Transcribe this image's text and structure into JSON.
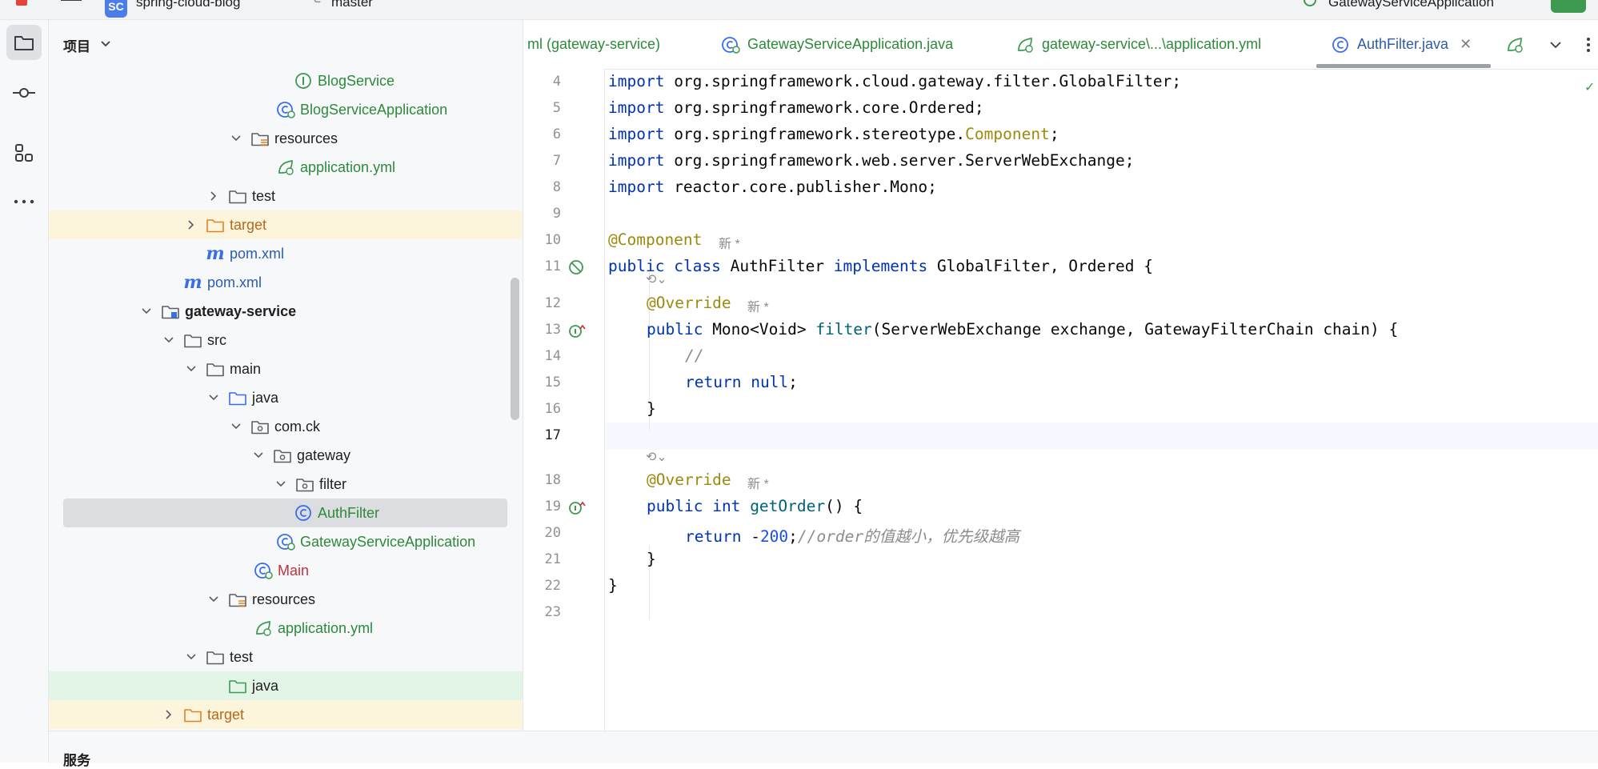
{
  "top_bar": {
    "project_badge": "SC",
    "project_name": "spring-cloud-blog",
    "branch": "master",
    "run_config": "GatewayServiceApplication"
  },
  "tool_strip": {
    "items": [
      {
        "name": "project",
        "icon": "folder-icon"
      },
      {
        "name": "commit",
        "icon": "commit-icon"
      },
      {
        "name": "structure",
        "icon": "structure-icon"
      },
      {
        "name": "more",
        "icon": "more-icon"
      }
    ]
  },
  "project_panel": {
    "title": "项目",
    "tree": [
      {
        "label": "BlogService",
        "icon": "interface",
        "color": "green"
      },
      {
        "label": "BlogServiceApplication",
        "icon": "spring-class",
        "color": "green"
      },
      {
        "label": "resources",
        "icon": "resources-folder",
        "color": "default",
        "expanded": true
      },
      {
        "label": "application.yml",
        "icon": "spring-yml",
        "color": "green"
      },
      {
        "label": "test",
        "icon": "folder",
        "color": "default",
        "expanded": false
      },
      {
        "label": "target",
        "icon": "orange-folder",
        "color": "orange",
        "expanded": false
      },
      {
        "label": "pom.xml",
        "icon": "maven",
        "color": "blue"
      },
      {
        "label": "pom.xml",
        "icon": "maven",
        "color": "blue"
      },
      {
        "label": "gateway-service",
        "icon": "module-folder",
        "color": "bold",
        "expanded": true
      },
      {
        "label": "src",
        "icon": "folder",
        "color": "default",
        "expanded": true
      },
      {
        "label": "main",
        "icon": "folder",
        "color": "default",
        "expanded": true
      },
      {
        "label": "java",
        "icon": "blue-folder",
        "color": "default",
        "expanded": true
      },
      {
        "label": "com.ck",
        "icon": "package",
        "color": "default",
        "expanded": true
      },
      {
        "label": "gateway",
        "icon": "package",
        "color": "default",
        "expanded": true
      },
      {
        "label": "filter",
        "icon": "package",
        "color": "default",
        "expanded": true
      },
      {
        "label": "AuthFilter",
        "icon": "class",
        "color": "green"
      },
      {
        "label": "GatewayServiceApplication",
        "icon": "spring-class",
        "color": "green"
      },
      {
        "label": "Main",
        "icon": "spring-class",
        "color": "red"
      },
      {
        "label": "resources",
        "icon": "resources-folder",
        "color": "default",
        "expanded": true
      },
      {
        "label": "application.yml",
        "icon": "spring-yml",
        "color": "green"
      },
      {
        "label": "test",
        "icon": "folder",
        "color": "default",
        "expanded": true
      },
      {
        "label": "java",
        "icon": "green-folder",
        "color": "default"
      },
      {
        "label": "target",
        "icon": "orange-folder",
        "color": "orange",
        "expanded": false
      }
    ]
  },
  "editor": {
    "tabs": [
      {
        "label": "ml (gateway-service)",
        "icon": "none"
      },
      {
        "label": "GatewayServiceApplication.java",
        "icon": "spring-class"
      },
      {
        "label": "gateway-service\\...\\application.yml",
        "icon": "spring-yml"
      },
      {
        "label": "AuthFilter.java",
        "icon": "class",
        "active": true
      }
    ],
    "line_numbers": [
      "4",
      "5",
      "6",
      "7",
      "8",
      "9",
      "10",
      "11",
      "12",
      "13",
      "14",
      "15",
      "16",
      "17",
      "18",
      "19",
      "20",
      "21",
      "22",
      "23"
    ],
    "inlay_hint": "新 *",
    "code": {
      "l4": {
        "kw": "import",
        "rest": " org.springframework.cloud.gateway.filter.GlobalFilter;"
      },
      "l5": {
        "kw": "import",
        "rest": " org.springframework.core.Ordered;"
      },
      "l6": {
        "kw": "import",
        "rest": " org.springframework.stereotype.",
        "ann": "Component",
        "tail": ";"
      },
      "l7": {
        "kw": "import",
        "rest": " org.springframework.web.server.ServerWebExchange;"
      },
      "l8": {
        "kw": "import",
        "rest": " reactor.core.publisher.Mono;"
      },
      "l10": {
        "ann": "@Component"
      },
      "l11": {
        "kw1": "public",
        "kw2": "class",
        "name": " AuthFilter ",
        "kw3": "implements",
        "rest": " GlobalFilter, Ordered {"
      },
      "l12": {
        "ann": "@Override"
      },
      "l13": {
        "kw": "public",
        "type": " Mono<Void> ",
        "fn": "filter",
        "rest": "(ServerWebExchange exchange, GatewayFilterChain chain) {"
      },
      "l14": {
        "cmt": "//"
      },
      "l15": {
        "kw": "return",
        "sp": " ",
        "kw2": "null",
        "rest": ";"
      },
      "l16": {
        "rest": "}"
      },
      "l18": {
        "ann": "@Override"
      },
      "l19": {
        "kw": "public",
        "sp": " ",
        "kw2": "int",
        "sp2": " ",
        "fn": "getOrder",
        "rest": "() {"
      },
      "l20": {
        "kw": "return",
        "rest": " -",
        "num": "200",
        "semi": ";",
        "cmt": "//order的值越小，优先级越高"
      },
      "l21": {
        "rest": "}"
      },
      "l22": {
        "rest": "}"
      }
    }
  },
  "bottom_panel": {
    "title": "服务"
  }
}
